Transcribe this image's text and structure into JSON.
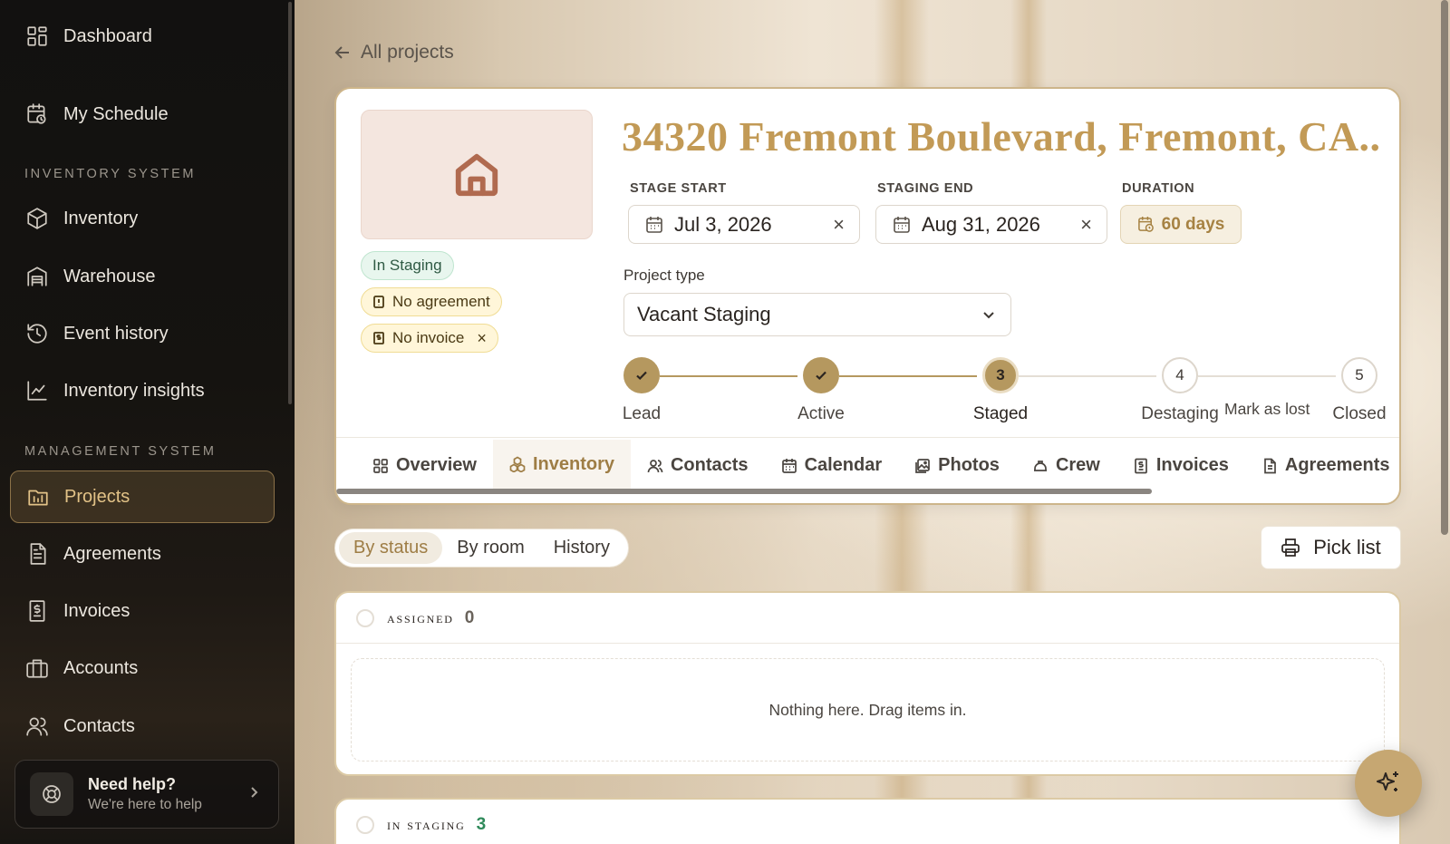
{
  "sidebar": {
    "items": [
      {
        "label": "Dashboard"
      },
      {
        "label": "My Schedule"
      },
      {
        "label": "Inventory"
      },
      {
        "label": "Warehouse"
      },
      {
        "label": "Event history"
      },
      {
        "label": "Inventory insights"
      },
      {
        "label": "Projects"
      },
      {
        "label": "Agreements"
      },
      {
        "label": "Invoices"
      },
      {
        "label": "Accounts"
      },
      {
        "label": "Contacts"
      }
    ],
    "sections": {
      "inventory": "INVENTORY SYSTEM",
      "management": "MANAGEMENT SYSTEM"
    },
    "active_item": "Projects",
    "help": {
      "title": "Need help?",
      "subtitle": "We're here to help"
    }
  },
  "breadcrumb": {
    "back_label": "All projects"
  },
  "project": {
    "title": "34320 Fremont Boulevard, Fremont, CA...",
    "badges": {
      "status": "In Staging",
      "agreement": "No agreement",
      "invoice": "No invoice"
    },
    "stage_start": {
      "label": "STAGE START",
      "value": "Jul 3, 2026"
    },
    "staging_end": {
      "label": "STAGING END",
      "value": "Aug 31, 2026"
    },
    "duration": {
      "label": "DURATION",
      "value": "60 days"
    },
    "project_type": {
      "label": "Project type",
      "value": "Vacant Staging"
    },
    "steps": [
      {
        "number": "1",
        "label": "Lead",
        "state": "done"
      },
      {
        "number": "2",
        "label": "Active",
        "state": "done"
      },
      {
        "number": "3",
        "label": "Staged",
        "state": "current"
      },
      {
        "number": "4",
        "label": "Destaging",
        "state": "todo"
      },
      {
        "number": "5",
        "label": "Closed",
        "state": "todo"
      }
    ],
    "mark_lost_label": "Mark as lost"
  },
  "tabs": [
    {
      "label": "Overview",
      "icon": "grid-icon"
    },
    {
      "label": "Inventory",
      "icon": "boxes-icon",
      "active": true
    },
    {
      "label": "Contacts",
      "icon": "users-icon"
    },
    {
      "label": "Calendar",
      "icon": "calendar-icon"
    },
    {
      "label": "Photos",
      "icon": "photos-icon"
    },
    {
      "label": "Crew",
      "icon": "hardhat-icon"
    },
    {
      "label": "Invoices",
      "icon": "invoice-icon"
    },
    {
      "label": "Agreements",
      "icon": "document-icon"
    }
  ],
  "view_toggle": {
    "options": [
      "By status",
      "By room",
      "History"
    ],
    "selected": "By status"
  },
  "pick_list_label": "Pick list",
  "groups": [
    {
      "name": "Assigned",
      "count": "0",
      "empty_text": "Nothing here. Drag items in."
    },
    {
      "name": "In staging",
      "count": "3"
    }
  ],
  "colors": {
    "accent": "#c29a56",
    "sidebar_bg": "#121110",
    "active_green": "#2f8a5a"
  }
}
